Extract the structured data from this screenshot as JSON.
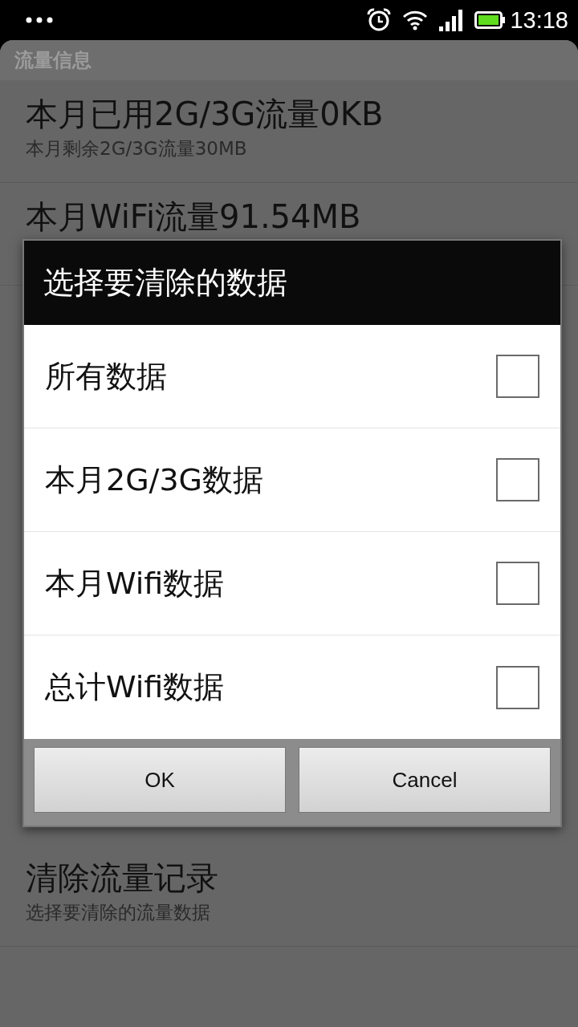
{
  "status_bar": {
    "time": "13:18"
  },
  "background": {
    "section_header": "流量信息",
    "rows": [
      {
        "title": "本月已用2G/3G流量0KB",
        "subtitle": "本月剩余2G/3G流量30MB"
      },
      {
        "title": "本月WiFi流量91.54MB"
      }
    ],
    "bottom_rows": [
      {
        "title": "清除流量记录",
        "subtitle": "选择要清除的流量数据"
      }
    ]
  },
  "dialog": {
    "title": "选择要清除的数据",
    "options": [
      {
        "label": "所有数据",
        "checked": false
      },
      {
        "label": "本月2G/3G数据",
        "checked": false
      },
      {
        "label": "本月Wifi数据",
        "checked": false
      },
      {
        "label": "总计Wifi数据",
        "checked": false
      }
    ],
    "buttons": [
      "OK",
      "Cancel"
    ]
  }
}
